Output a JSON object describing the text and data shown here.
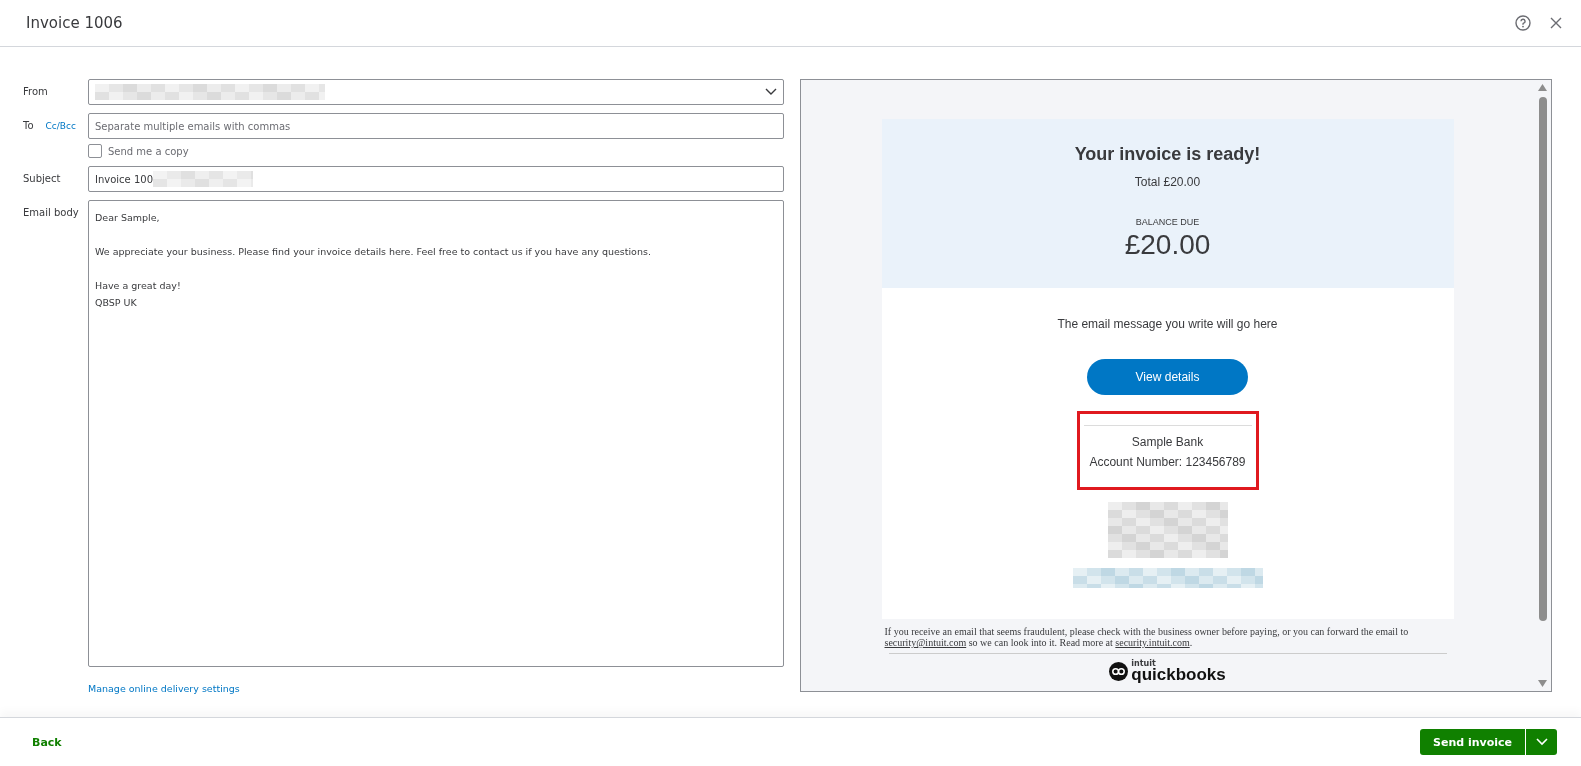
{
  "window": {
    "title": "Invoice 1006"
  },
  "form": {
    "from": {
      "label": "From"
    },
    "to": {
      "label": "To",
      "cc_link": "Cc/Bcc",
      "placeholder": "Separate multiple emails with commas"
    },
    "send_copy": {
      "label": "Send me a copy",
      "checked": false
    },
    "subject": {
      "label": "Subject",
      "value": "Invoice 100"
    },
    "body": {
      "label": "Email body",
      "value": "Dear Sample,\n\nWe appreciate your business. Please find your invoice details here. Feel free to contact us if you have any questions.\n\nHave a great day!\nQBSP UK"
    },
    "manage_link": "Manage online delivery settings"
  },
  "preview": {
    "heading": "Your invoice is ready!",
    "total": "Total £20.00",
    "balance_label": "BALANCE DUE",
    "balance": "£20.00",
    "message": "The email message you write will go here",
    "button": "View details",
    "bank": {
      "name": "Sample Bank",
      "account": "Account Number: 123456789"
    },
    "notice": {
      "before": "If you receive an email that seems fraudulent, please check with the business owner before paying, or you can forward the email to ",
      "email": "security@intuit.com",
      "middle": " so we can look into it. Read more at ",
      "site": "security.intuit.com",
      "after": "."
    },
    "logo": {
      "brand": "intuit",
      "name": "quickbooks"
    }
  },
  "footer": {
    "back": "Back",
    "send": "Send invoice"
  }
}
